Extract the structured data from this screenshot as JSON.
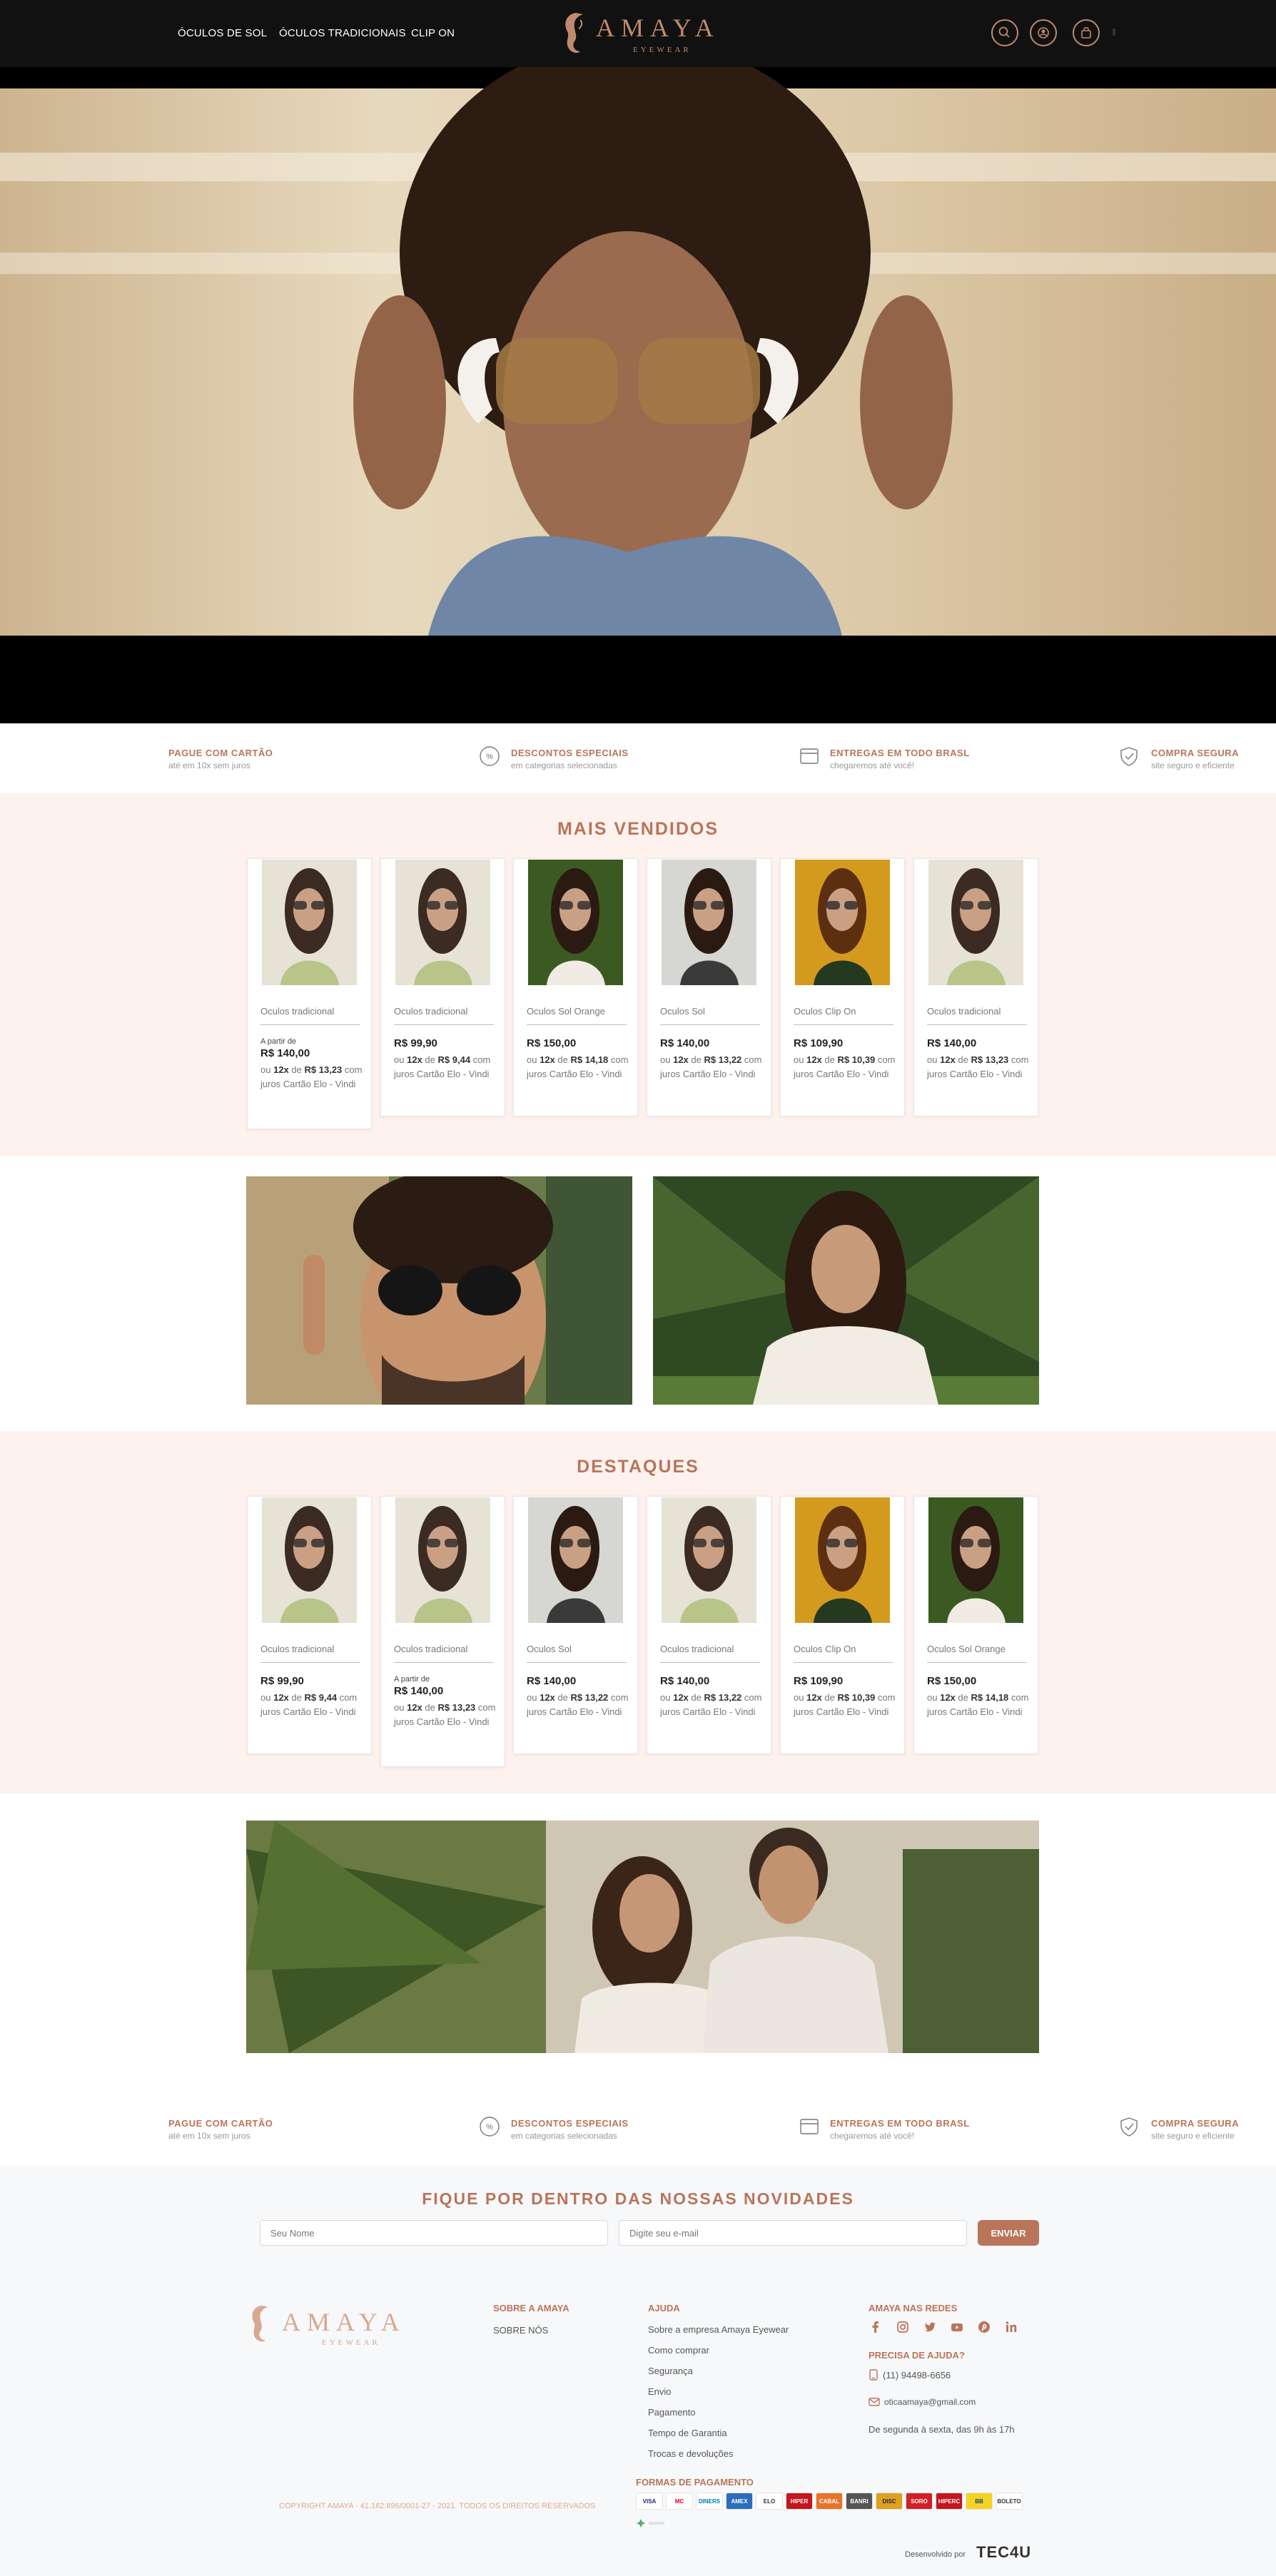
{
  "header": {
    "nav": [
      "ÓCULOS DE SOL",
      "ÓCULOS TRADICIONAIS",
      "CLIP ON"
    ],
    "logo": {
      "brand": "AMAYA",
      "tagline": "EYEWEAR"
    },
    "icons": [
      "search-icon",
      "user-icon",
      "bag-icon"
    ]
  },
  "benefits": [
    {
      "title": "PAGUE COM CARTÃO",
      "subtitle": "até em 10x sem juros",
      "icon": "card-icon"
    },
    {
      "title": "DESCONTOS ESPECIAIS",
      "subtitle": "em categorias selecionadas",
      "icon": "percent-icon"
    },
    {
      "title": "ENTREGAS EM TODO BRASL",
      "subtitle": "chegaremos até você!",
      "icon": "box-icon"
    },
    {
      "title": "COMPRA SEGURA",
      "subtitle": "site seguro e eficiente",
      "icon": "shield-icon"
    }
  ],
  "best_sellers": {
    "title": "MAIS VENDIDOS",
    "products": [
      {
        "name": "Oculos tradicional",
        "from": "A partir de",
        "price": "R$ 140,00",
        "inst_count": "12x",
        "inst_value": "R$ 13,23",
        "inst_text": "com juros Cartão Elo - Vindi"
      },
      {
        "name": "Oculos tradicional",
        "from": "",
        "price": "R$ 99,90",
        "inst_count": "12x",
        "inst_value": "R$ 9,44",
        "inst_text": "com juros Cartão Elo - Vindi"
      },
      {
        "name": "Oculos Sol Orange",
        "from": "",
        "price": "R$ 150,00",
        "inst_count": "12x",
        "inst_value": "R$ 14,18",
        "inst_text": "com juros Cartão Elo - Vindi"
      },
      {
        "name": "Oculos Sol",
        "from": "",
        "price": "R$ 140,00",
        "inst_count": "12x",
        "inst_value": "R$ 13,22",
        "inst_text": "com juros Cartão Elo - Vindi"
      },
      {
        "name": "Oculos Clip On",
        "from": "",
        "price": "R$ 109,90",
        "inst_count": "12x",
        "inst_value": "R$ 10,39",
        "inst_text": "com juros Cartão Elo - Vindi"
      },
      {
        "name": "Oculos tradicional",
        "from": "",
        "price": "R$ 140,00",
        "inst_count": "12x",
        "inst_value": "R$ 13,23",
        "inst_text": "com juros Cartão Elo - Vindi"
      }
    ]
  },
  "highlights": {
    "title": "DESTAQUES",
    "products": [
      {
        "name": "Oculos tradicional",
        "from": "",
        "price": "R$ 99,90",
        "inst_count": "12x",
        "inst_value": "R$ 9,44",
        "inst_text": "com juros Cartão Elo - Vindi"
      },
      {
        "name": "Oculos tradicional",
        "from": "A partir de",
        "price": "R$ 140,00",
        "inst_count": "12x",
        "inst_value": "R$ 13,23",
        "inst_text": "com juros Cartão Elo - Vindi"
      },
      {
        "name": "Oculos Sol",
        "from": "",
        "price": "R$ 140,00",
        "inst_count": "12x",
        "inst_value": "R$ 13,22",
        "inst_text": "com juros Cartão Elo - Vindi"
      },
      {
        "name": "Oculos tradicional",
        "from": "",
        "price": "R$ 140,00",
        "inst_count": "12x",
        "inst_value": "R$ 13,22",
        "inst_text": "com juros Cartão Elo - Vindi"
      },
      {
        "name": "Oculos Clip On",
        "from": "",
        "price": "R$ 109,90",
        "inst_count": "12x",
        "inst_value": "R$ 10,39",
        "inst_text": "com juros Cartão Elo - Vindi"
      },
      {
        "name": "Oculos Sol Orange",
        "from": "",
        "price": "R$ 150,00",
        "inst_count": "12x",
        "inst_value": "R$ 14,18",
        "inst_text": "com juros Cartão Elo - Vindi"
      }
    ]
  },
  "installment_prefix": "ou",
  "installment_of": "de",
  "newsletter": {
    "title": "FIQUE POR DENTRO DAS NOSSAS NOVIDADES",
    "name_placeholder": "Seu Nome",
    "email_placeholder": "Digite seu e-mail",
    "submit": "ENVIAR"
  },
  "footer": {
    "about": {
      "title": "SOBRE A AMAYA",
      "links": [
        "SOBRE NÓS"
      ]
    },
    "help": {
      "title": "AJUDA",
      "links": [
        "Sobre a empresa Amaya Eyewear",
        "Como comprar",
        "Segurança",
        "Envio",
        "Pagamento",
        "Tempo de Garantia",
        "Trocas e devoluções"
      ]
    },
    "social": {
      "title": "AMAYA NAS REDES",
      "icons": [
        "facebook-icon",
        "instagram-icon",
        "twitter-icon",
        "youtube-icon",
        "pinterest-icon",
        "linkedin-icon"
      ]
    },
    "contact": {
      "title": "PRECISA DE AJUDA?",
      "phone": "(11) 94498-6656",
      "email": "oticaamaya@gmail.com",
      "hours": "De segunda à sexta, das 9h às 17h"
    },
    "payment_title": "FORMAS DE PAGAMENTO",
    "payment_methods": [
      "VISA",
      "MC",
      "DINERS",
      "AMEX",
      "ELO",
      "HIPER",
      "CABAL",
      "BANRI",
      "DISC",
      "SORO",
      "HIPERC",
      "BB",
      "BOLETO"
    ],
    "copyright": "COPYRIGHT AMAYA - 41.162.896/0001-27 - 2021. TODOS OS DIREITOS RESERVADOS",
    "developed_by": "Desenvolvido por",
    "developer": "TEC4U"
  },
  "colors": {
    "accent": "#b9755a",
    "section_bg": "#fdf2ee",
    "header_bg": "#111111",
    "footer_bg": "#f7f8fa"
  }
}
